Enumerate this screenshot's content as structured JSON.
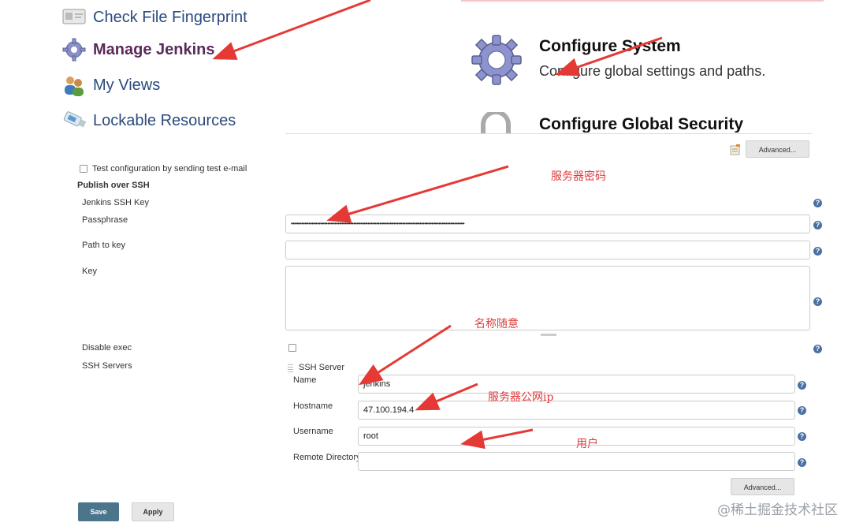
{
  "menu": {
    "items": [
      {
        "label": "Check File Fingerprint",
        "icon": "fingerprint-card-icon"
      },
      {
        "label": "Manage Jenkins",
        "icon": "gear-icon"
      },
      {
        "label": "My Views",
        "icon": "users-icon"
      },
      {
        "label": "Lockable Resources",
        "icon": "usb-drive-icon"
      }
    ]
  },
  "configure": {
    "system_title": "Configure System",
    "system_desc": "Configure global settings and paths.",
    "security_title": "Configure Global Security"
  },
  "form": {
    "advanced_label": "Advanced...",
    "test_config_label": "Test configuration by sending test e-mail",
    "publish_over_ssh": "Publish over SSH",
    "jenkins_ssh_key": "Jenkins SSH Key",
    "passphrase_label": "Passphrase",
    "passphrase_value": "••••••••••••••••••••••••••••••••••••••••••••••••••••••••••••••••••••••••••••••••••••••••••••••••••••",
    "path_to_key_label": "Path to key",
    "key_label": "Key",
    "disable_exec_label": "Disable exec",
    "ssh_servers_label": "SSH Servers",
    "ssh_server_header": "SSH Server",
    "name_label": "Name",
    "name_value": "jenkins",
    "hostname_label": "Hostname",
    "hostname_value": "47.100.194.4",
    "username_label": "Username",
    "username_value": "root",
    "remote_dir_label": "Remote Directory",
    "remote_dir_value": "",
    "save_label": "Save",
    "apply_label": "Apply"
  },
  "annotations": {
    "server_password": "服务器密码",
    "name_any": "名称随意",
    "server_public_ip": "服务器公网ip",
    "user": "用户"
  },
  "watermark": "@稀土掘金技术社区",
  "colors": {
    "arrow": "#e53935",
    "link_blue": "#2b4a7e",
    "active_purple": "#5a2a5c",
    "save_button": "#4b758b"
  }
}
